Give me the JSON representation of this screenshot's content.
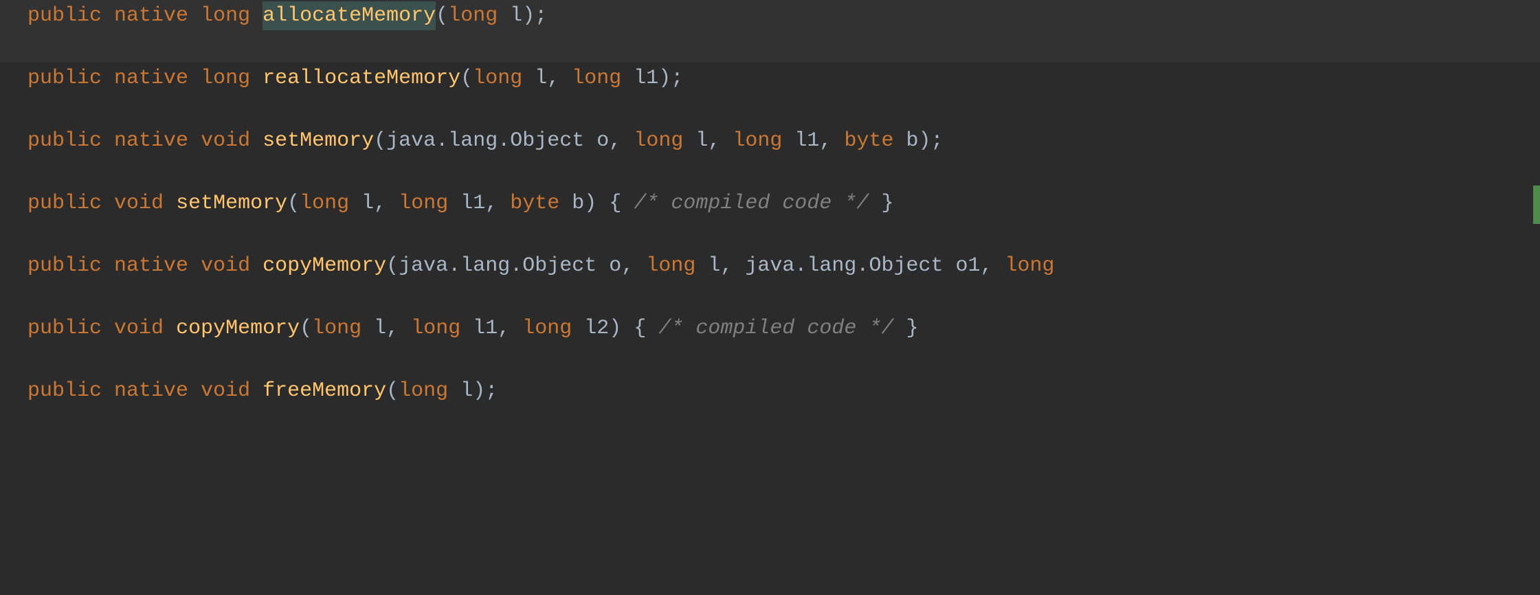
{
  "code": {
    "kw_public": "public",
    "kw_native": "native",
    "kw_long": "long",
    "kw_void": "void",
    "kw_byte": "byte",
    "sp": " ",
    "comma_sp": ", ",
    "lparen": "(",
    "rparen": ")",
    "semicolon": ";",
    "lbrace": "{",
    "rbrace": "}",
    "dot": ".",
    "type_java": "java",
    "type_lang": "lang",
    "type_Object": "Object",
    "m_allocateMemory": "allocateMemory",
    "m_reallocateMemory": "reallocateMemory",
    "m_setMemory": "setMemory",
    "m_copyMemory": "copyMemory",
    "m_freeMemory": "freeMemory",
    "p_l": "l",
    "p_l1": "l1",
    "p_l2": "l2",
    "p_o": "o",
    "p_o1": "o1",
    "p_b": "b",
    "compiled_comment": "/* compiled code */"
  }
}
